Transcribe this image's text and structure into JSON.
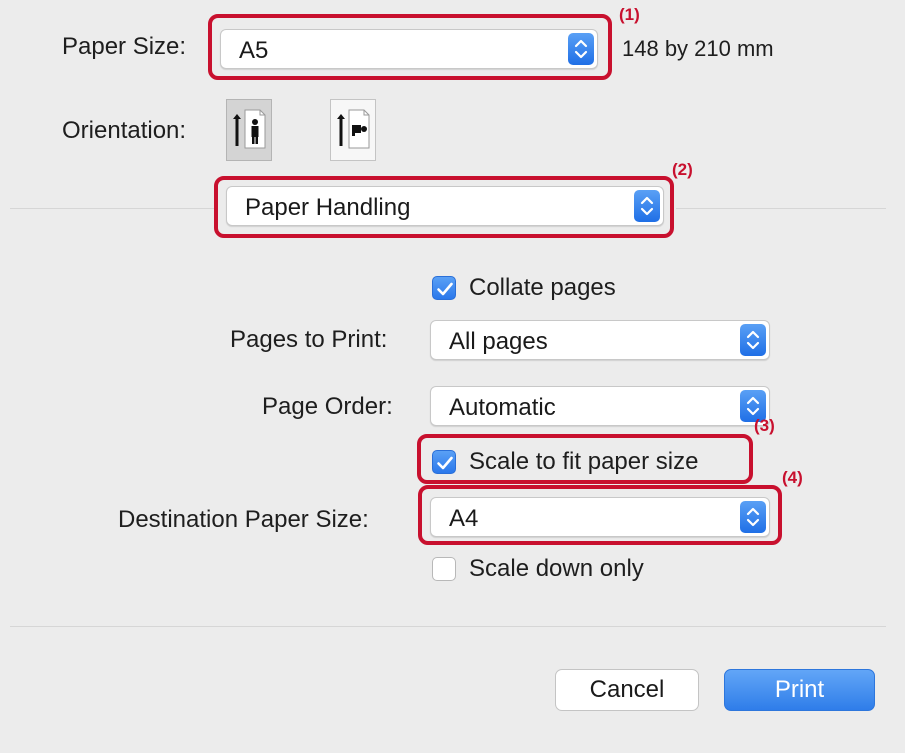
{
  "paper_size": {
    "label": "Paper Size:",
    "value": "A5",
    "dimensions": "148 by 210 mm"
  },
  "orientation": {
    "label": "Orientation:",
    "options": [
      "portrait",
      "landscape"
    ],
    "selected": "portrait"
  },
  "section_menu": {
    "value": "Paper Handling"
  },
  "collate": {
    "label": "Collate pages",
    "checked": true
  },
  "pages_to_print": {
    "label": "Pages to Print:",
    "value": "All pages"
  },
  "page_order": {
    "label": "Page Order:",
    "value": "Automatic"
  },
  "scale_to_fit": {
    "label": "Scale to fit paper size",
    "checked": true
  },
  "destination_paper_size": {
    "label": "Destination Paper Size:",
    "value": "A4"
  },
  "scale_down_only": {
    "label": "Scale down only",
    "checked": false
  },
  "buttons": {
    "cancel": "Cancel",
    "print": "Print"
  },
  "callouts": [
    "(1)",
    "(2)",
    "(3)",
    "(4)"
  ],
  "colors": {
    "accent": "#2a78eb",
    "callout": "#c8102e",
    "background": "#ececec"
  }
}
